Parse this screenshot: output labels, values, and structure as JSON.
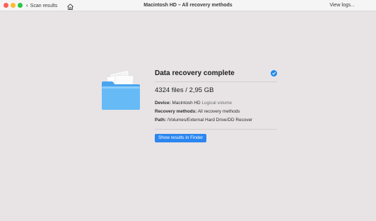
{
  "titlebar": {
    "back_label": "Scan results",
    "title": "Macintosh HD – All recovery methods",
    "view_logs_label": "View logs..."
  },
  "result": {
    "heading": "Data recovery complete",
    "summary": "4324 files / 2,95 GB",
    "device_key": "Device:",
    "device_value": "Macintosh HD",
    "device_note": "Logical volume",
    "methods_key": "Recovery methods:",
    "methods_value": "All recovery methods",
    "path_key": "Path:",
    "path_value": "/Volumes/External Hard Drive/DD Recover",
    "button_label": "Show results in Finder"
  },
  "colors": {
    "accent": "#2b86f0",
    "check": "#1e88ea",
    "folder": "#5eb4f4"
  },
  "icons": {
    "back": "chevron-left-icon",
    "home": "home-icon",
    "folder": "folder-with-documents-icon",
    "status": "checkmark-circle-icon"
  }
}
